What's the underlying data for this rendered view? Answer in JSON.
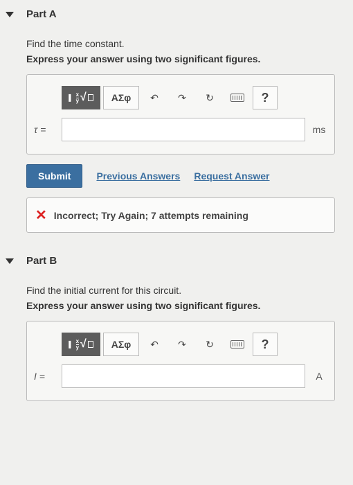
{
  "partA": {
    "title": "Part A",
    "prompt": "Find the time constant.",
    "instruct": "Express your answer using two significant figures.",
    "tools": {
      "math": "√",
      "greek": "ΑΣφ",
      "help": "?"
    },
    "varLabel": "τ =",
    "input": "",
    "unit": "ms",
    "submit": "Submit",
    "prevAns": "Previous Answers",
    "reqAns": "Request Answer",
    "feedback": "Incorrect; Try Again; 7 attempts remaining"
  },
  "partB": {
    "title": "Part B",
    "prompt": "Find the initial current for this circuit.",
    "instruct": "Express your answer using two significant figures.",
    "tools": {
      "math": "√",
      "greek": "ΑΣφ",
      "help": "?"
    },
    "varLabel": "I =",
    "input": "",
    "unit": "A"
  }
}
